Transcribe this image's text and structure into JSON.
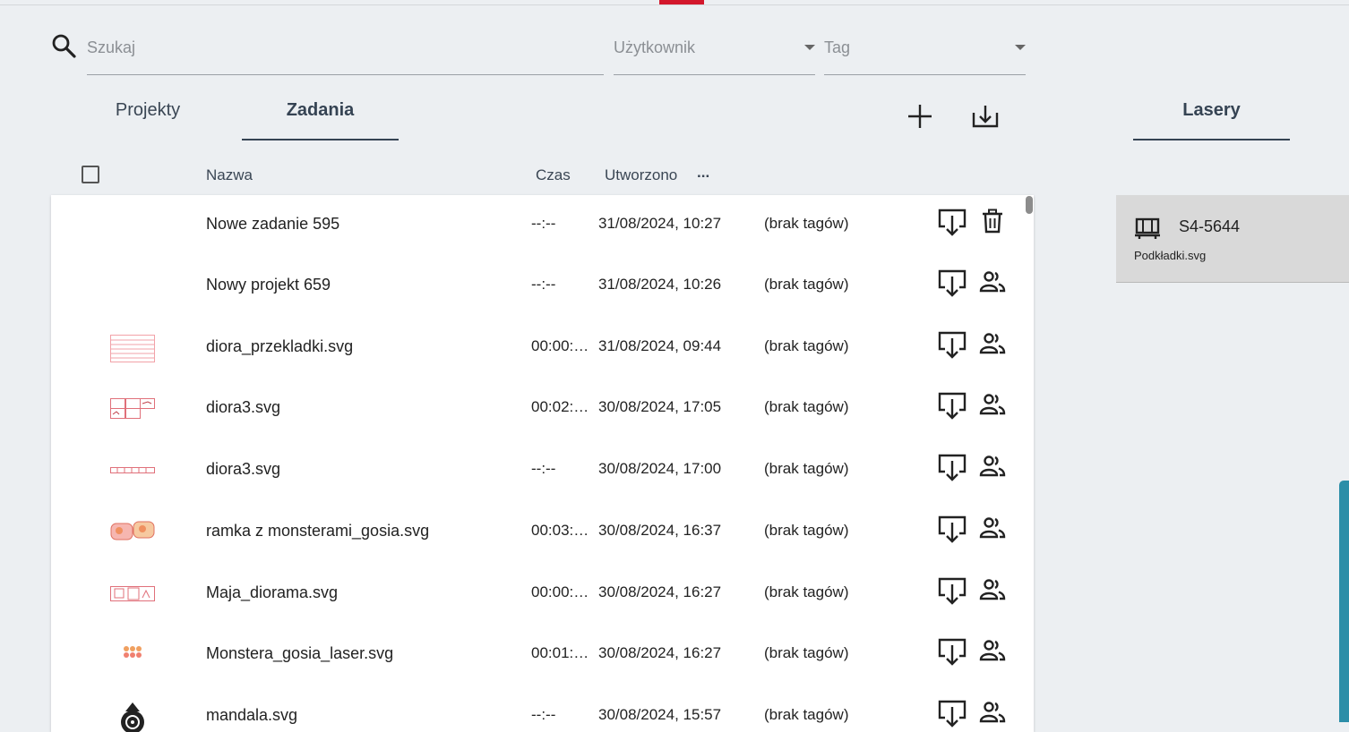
{
  "search": {
    "placeholder": "Szukaj"
  },
  "filters": {
    "user_label": "Użytkownik",
    "tag_label": "Tag"
  },
  "tabs": [
    {
      "label": "Projekty"
    },
    {
      "label": "Zadania"
    }
  ],
  "right_panel": {
    "tab_label": "Lasery",
    "laser": {
      "id": "S4-5644",
      "file": "Podkładki.svg"
    }
  },
  "table": {
    "headers": {
      "name": "Nazwa",
      "time": "Czas",
      "created": "Utworzono",
      "more": "..."
    },
    "rows": [
      {
        "name": "Nowe zadanie 595",
        "time": "--:--",
        "created": "31/08/2024, 10:27",
        "tags": "(brak tagów)",
        "second_action": "trash-icon"
      },
      {
        "name": "Nowy projekt 659",
        "time": "--:--",
        "created": "31/08/2024, 10:26",
        "tags": "(brak tagów)",
        "second_action": "share-users-icon"
      },
      {
        "name": "diora_przekladki.svg",
        "time": "00:00:…",
        "created": "31/08/2024, 09:44",
        "tags": "(brak tagów)",
        "second_action": "share-users-icon"
      },
      {
        "name": "diora3.svg",
        "time": "00:02:…",
        "created": "30/08/2024, 17:05",
        "tags": "(brak tagów)",
        "second_action": "share-users-icon"
      },
      {
        "name": "diora3.svg",
        "time": "--:--",
        "created": "30/08/2024, 17:00",
        "tags": "(brak tagów)",
        "second_action": "share-users-icon"
      },
      {
        "name": "ramka z monsterami_gosia.svg",
        "time": "00:03:…",
        "created": "30/08/2024, 16:37",
        "tags": "(brak tagów)",
        "second_action": "share-users-icon"
      },
      {
        "name": "Maja_diorama.svg",
        "time": "00:00:…",
        "created": "30/08/2024, 16:27",
        "tags": "(brak tagów)",
        "second_action": "share-users-icon"
      },
      {
        "name": "Monstera_gosia_laser.svg",
        "time": "00:01:…",
        "created": "30/08/2024, 16:27",
        "tags": "(brak tagów)",
        "second_action": "share-users-icon"
      },
      {
        "name": "mandala.svg",
        "time": "--:--",
        "created": "30/08/2024, 15:57",
        "tags": "(brak tagów)",
        "second_action": "share-users-icon"
      }
    ]
  },
  "colors": {
    "accent_red": "#d3172c",
    "tab_underline": "#354353",
    "scroll_accent": "#2c8ea8"
  }
}
